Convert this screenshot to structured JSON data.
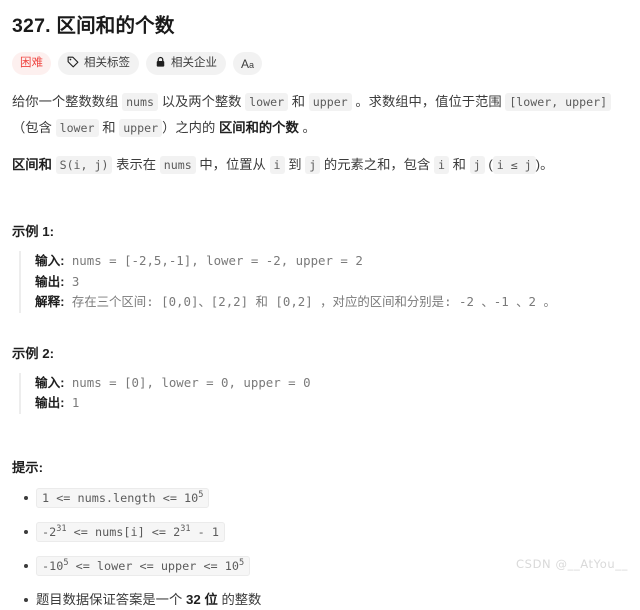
{
  "problem": {
    "title": "327. 区间和的个数",
    "difficulty": "困难",
    "tags_label": "相关标签",
    "companies_label": "相关企业",
    "font_toggle": "Aa"
  },
  "description": {
    "p1_seg1": "给你一个整数数组 ",
    "p1_code1": "nums",
    "p1_seg2": " 以及两个整数 ",
    "p1_code2": "lower",
    "p1_seg3": " 和 ",
    "p1_code3": "upper",
    "p1_seg4": " 。求数组中，值位于范围 ",
    "p1_code4": "[lower, upper]",
    "p1_seg5": " （包含 ",
    "p1_code5": "lower",
    "p1_seg6": " 和 ",
    "p1_code6": "upper",
    "p1_seg7": "）之内的 ",
    "p1_bold": "区间和的个数",
    "p1_seg8": " 。",
    "p2_bold": "区间和",
    "p2_seg1": " ",
    "p2_code1": "S(i, j)",
    "p2_seg2": " 表示在 ",
    "p2_code2": "nums",
    "p2_seg3": " 中，位置从 ",
    "p2_code3": "i",
    "p2_seg4": " 到 ",
    "p2_code4": "j",
    "p2_seg5": " 的元素之和，包含 ",
    "p2_code5": "i",
    "p2_seg6": " 和 ",
    "p2_code6": "j",
    "p2_seg7": " (",
    "p2_code7": "i ≤ j",
    "p2_seg8": ")。"
  },
  "examples": [
    {
      "head": "示例 1:",
      "input_label": "输入:",
      "input_value": " nums = [-2,5,-1], lower = -2, upper = 2",
      "output_label": "输出:",
      "output_value": " 3",
      "explain_label": "解释:",
      "explain_value": " 存在三个区间: [0,0]、[2,2] 和 [0,2] ，对应的区间和分别是: -2 、-1 、2 。"
    },
    {
      "head": "示例 2:",
      "input_label": "输入:",
      "input_value": " nums = [0], lower = 0, upper = 0",
      "output_label": "输出:",
      "output_value": " 1",
      "explain_label": "",
      "explain_value": ""
    }
  ],
  "hints": {
    "head": "提示:",
    "items": [
      {
        "type": "code",
        "pre": "1 <= nums.length <= 10",
        "sup": "5",
        "post": ""
      },
      {
        "type": "code_multi",
        "a_pre": "-2",
        "a_sup": "31",
        "a_mid": " <= nums[i] <= 2",
        "a_sup2": "31",
        "a_post": " - 1"
      },
      {
        "type": "code_multi2",
        "b_pre": "-10",
        "b_sup": "5",
        "b_mid": " <= lower <= upper <= 10",
        "b_sup2": "5",
        "b_post": ""
      },
      {
        "type": "text",
        "t_pre": "题目数据保证答案是一个 ",
        "t_bold": "32 位",
        "t_post": " 的整数"
      }
    ]
  },
  "watermark": "CSDN @__AtYou__",
  "colors": {
    "difficulty_text": "#ef4743",
    "difficulty_bg": "#fdf0ef",
    "badge_bg": "#f2f2f2",
    "code_bg": "#f2f2f2",
    "text": "#3c3c3c",
    "watermark": "#d9d9d9"
  }
}
